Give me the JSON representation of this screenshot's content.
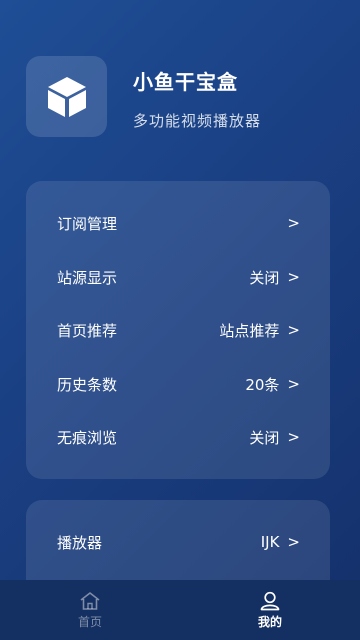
{
  "app": {
    "title": "小鱼干宝盒",
    "subtitle": "多功能视频播放器",
    "icon": "cube-icon"
  },
  "settings": [
    {
      "label": "订阅管理",
      "value": "",
      "chevron": ">"
    },
    {
      "label": "站源显示",
      "value": "关闭",
      "chevron": ">"
    },
    {
      "label": "首页推荐",
      "value": "站点推荐",
      "chevron": ">"
    },
    {
      "label": "历史条数",
      "value": "20条",
      "chevron": ">"
    },
    {
      "label": "无痕浏览",
      "value": "关闭",
      "chevron": ">"
    }
  ],
  "player_settings": [
    {
      "label": "播放器",
      "value": "IJK",
      "chevron": ">"
    }
  ],
  "bottom_nav": [
    {
      "label": "首页",
      "icon": "home-icon",
      "active": false
    },
    {
      "label": "我的",
      "icon": "profile-icon",
      "active": true
    }
  ],
  "colors": {
    "background_top": "#1f4e96",
    "background_bottom": "#14306a",
    "nav_background": "#142f61"
  }
}
